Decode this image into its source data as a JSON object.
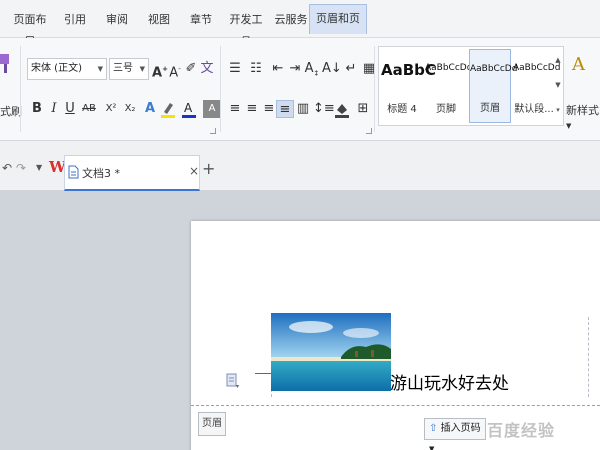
{
  "menu": {
    "tabs": [
      {
        "label": "页面布局"
      },
      {
        "label": "引用"
      },
      {
        "label": "审阅"
      },
      {
        "label": "视图"
      },
      {
        "label": "章节"
      },
      {
        "label": "开发工具"
      },
      {
        "label": "云服务"
      },
      {
        "label": "页眉和页脚"
      }
    ],
    "active_index": 7
  },
  "ribbon": {
    "format_painter_label": "式刷",
    "font_name": "宋体 (正文)",
    "font_size": "三号",
    "styles": [
      {
        "sample": "AaBbC",
        "name": "标题 4"
      },
      {
        "sample": "AaBbCcDd",
        "name": "页脚"
      },
      {
        "sample": "AaBbCcDd",
        "name": "页眉"
      },
      {
        "sample": "AaBbCcDd",
        "name": "默认段..."
      }
    ],
    "new_style_label": "新样式"
  },
  "docbar": {
    "doc_name": "文档3 *",
    "close_glyph": "×",
    "new_tab_glyph": "+"
  },
  "page": {
    "headline": "游山玩水好去处",
    "header_label": "页眉",
    "insert_page_number_label": "插入页码"
  },
  "watermark": "百度经验",
  "colors": {
    "active_tab_bg": "#d7e3f4",
    "doc_tab_underline": "#3b76d6",
    "workspace_bg": "#cfd3da",
    "wps_logo": "#d9302c"
  }
}
